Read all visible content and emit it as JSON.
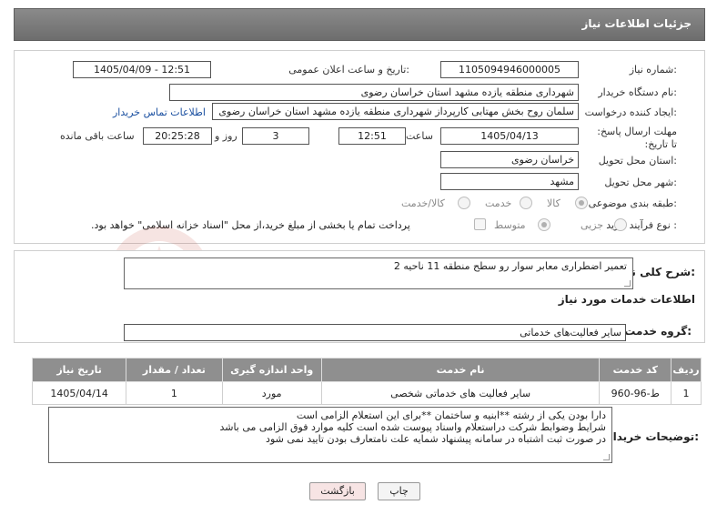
{
  "header": {
    "title": "جزئیات اطلاعات نیاز"
  },
  "fields": {
    "need_number_label": "شماره نیاز:",
    "need_number": "1105094946000005",
    "announce_label": "تاریخ و ساعت اعلان عمومی:",
    "announce_value": "1405/04/09 - 12:51",
    "buyer_org_label": "نام دستگاه خریدار:",
    "buyer_org": "شهرداری منطقه یازده مشهد استان خراسان رضوی",
    "creator_label": "ایجاد کننده درخواست:",
    "creator": "سلمان روح بخش مهتابی کارپرداز شهرداری منطقه یازده مشهد استان خراسان رضوی",
    "contact_link": "اطلاعات تماس خریدار",
    "deadline_label": "مهلت ارسال پاسخ: تا تاریخ:",
    "deadline_date": "1405/04/13",
    "hour_label": "ساعت",
    "deadline_time": "12:51",
    "days_value": "3",
    "days_label": "روز و",
    "remaining_time": "20:25:28",
    "remaining_label": "ساعت باقی مانده",
    "province_label": "استان محل تحویل:",
    "province": "خراسان رضوی",
    "city_label": "شهر محل تحویل:",
    "city": "مشهد",
    "category_label": "طبقه بندی موضوعی:",
    "category_options": [
      "کالا",
      "خدمت",
      "کالا/خدمت"
    ],
    "purchase_type_label": "نوع فرآیند خرید :",
    "purchase_options": [
      "جزیی",
      "متوسط"
    ],
    "payment_note": "پرداخت تمام یا بخشی از مبلغ خرید،از محل \"اسناد خزانه اسلامی\" خواهد بود."
  },
  "description": {
    "label": "شرح کلی نیاز:",
    "value": "تعمیر اضطراری معابر سوار رو سطح منطقه 11 ناحیه 2"
  },
  "services": {
    "section_title": "اطلاعات خدمات مورد نیاز",
    "group_label": "گروه خدمت:",
    "group_value": "سایر فعالیت‌های خدماتی",
    "columns": [
      "ردیف",
      "کد خدمت",
      "نام خدمت",
      "واحد اندازه گیری",
      "تعداد / مقدار",
      "تاریخ نیاز"
    ],
    "rows": [
      {
        "row": "1",
        "code": "ط-96-960",
        "name": "سایر فعالیت های خدماتی شخصی",
        "unit": "مورد",
        "qty": "1",
        "date": "1405/04/14"
      }
    ]
  },
  "buyer_notes": {
    "label": "توضیحات خریدار:",
    "lines": [
      "دارا بودن یکی از رشته **ابنیه و ساختمان **برای این استعلام الزامی است",
      "شرایط وضوابط شرکت دراستعلام واسناد پیوست شده است کلیه موارد فوق الزامی می باشد",
      "در صورت ثبت اشتباه در سامانه پیشنهاد شمایه علت نامتعارف بودن تایید نمی شود"
    ]
  },
  "buttons": {
    "print": "چاپ",
    "back": "بازگشت"
  },
  "watermark": {
    "text": "AriaTender.neT"
  },
  "colors": {
    "title_bar": "#7a7a7a",
    "table_header": "#8f8f8f",
    "link": "#1a4fa0",
    "back_button_bg": "#f7e4e4"
  }
}
